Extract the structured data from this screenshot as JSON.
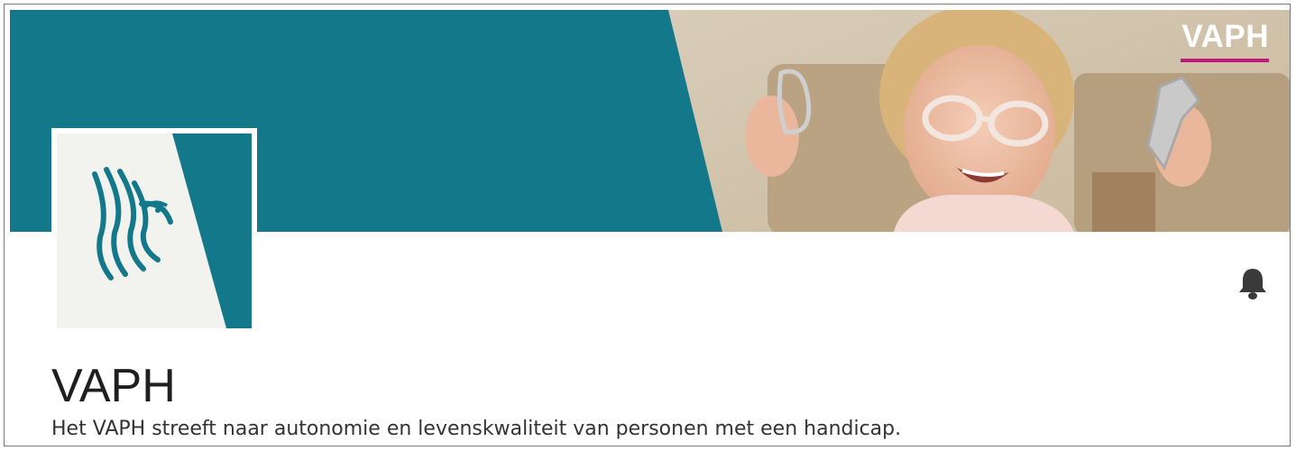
{
  "banner": {
    "brand_text": "VAPH",
    "colors": {
      "teal": "#13788a",
      "accent": "#c2187a"
    }
  },
  "logo": {
    "icon": "flemish-lion-icon"
  },
  "actions": {
    "notification_icon": "bell-icon"
  },
  "profile": {
    "title": "VAPH",
    "description": "Het VAPH streeft naar autonomie en levenskwaliteit van personen met een handicap."
  }
}
